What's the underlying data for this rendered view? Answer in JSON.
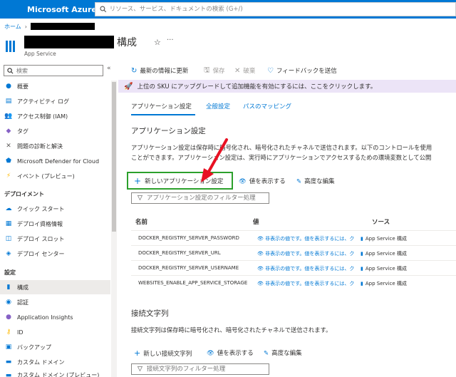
{
  "topbar": {
    "brand": "Microsoft Azure",
    "search_placeholder": "リソース、サービス、ドキュメントの検索 (G+/)"
  },
  "breadcrumb": {
    "home": "ホーム"
  },
  "resource": {
    "title": "構成",
    "type": "App Service",
    "star": "☆",
    "more": "···"
  },
  "sidebar": {
    "search_placeholder": "検索",
    "collapse": "«",
    "items_top": [
      {
        "label": "概要",
        "icon": "globe-icon",
        "color": "#0078d4"
      },
      {
        "label": "アクティビティ ログ",
        "icon": "log-icon",
        "color": "#0078d4"
      },
      {
        "label": "アクセス制御 (IAM)",
        "icon": "people-icon",
        "color": "#0078d4"
      },
      {
        "label": "タグ",
        "icon": "tag-icon",
        "color": "#8661c5"
      },
      {
        "label": "問題の診断と解決",
        "icon": "wrench-icon",
        "color": "#605e5c"
      },
      {
        "label": "Microsoft Defender for Cloud",
        "icon": "shield-icon",
        "color": "#0078d4"
      },
      {
        "label": "イベント (プレビュー)",
        "icon": "lightning-icon",
        "color": "#ffb900"
      }
    ],
    "group_deploy": "デプロイメント",
    "items_deploy": [
      {
        "label": "クイック スタート",
        "icon": "cloud-icon",
        "color": "#0078d4"
      },
      {
        "label": "デプロイ資格情報",
        "icon": "credentials-icon",
        "color": "#0078d4"
      },
      {
        "label": "デプロイ スロット",
        "icon": "slot-icon",
        "color": "#0078d4"
      },
      {
        "label": "デプロイ センター",
        "icon": "cube-icon",
        "color": "#0078d4"
      }
    ],
    "group_settings": "設定",
    "items_settings": [
      {
        "label": "構成",
        "icon": "config-icon",
        "color": "#0078d4"
      },
      {
        "label": "認証",
        "icon": "auth-icon",
        "color": "#0078d4"
      },
      {
        "label": "Application Insights",
        "icon": "bulb-icon",
        "color": "#8661c5"
      },
      {
        "label": "ID",
        "icon": "key-icon",
        "color": "#ffb900"
      },
      {
        "label": "バックアップ",
        "icon": "backup-icon",
        "color": "#0078d4"
      },
      {
        "label": "カスタム ドメイン",
        "icon": "domain-icon",
        "color": "#0078d4"
      },
      {
        "label": "カスタム ドメイン (プレビュー)",
        "icon": "domain-icon",
        "color": "#0078d4"
      }
    ]
  },
  "toolbar": {
    "refresh": "最新の情報に更新",
    "save": "保存",
    "discard": "破棄",
    "feedback": "フィードバックを送信"
  },
  "banner": {
    "text": "上位の SKU にアップグレードして追加機能を有効にするには、ここをクリックします。"
  },
  "tabs": {
    "app_settings": "アプリケーション設定",
    "general": "全般設定",
    "path_mapping": "パスのマッピング"
  },
  "app_section": {
    "title": "アプリケーション設定",
    "desc_line1": "アプリケーション設定は保存時に暗号化され、暗号化されたチャネルで送信されます。以下のコントロールを使用",
    "desc_line2": "ことができます。アプリケーション設定は、実行時にアプリケーションでアクセスするための環境変数として公開",
    "new_button": "新しいアプリケーション設定",
    "show_values": "値を表示する",
    "advanced_edit": "高度な編集",
    "filter_placeholder": "アプリケーション設定のフィルター処理"
  },
  "table": {
    "headers": {
      "name": "名前",
      "value": "値",
      "source": "ソース"
    },
    "rows": [
      {
        "name": "DOCKER_REGISTRY_SERVER_PASSWORD",
        "value": "非表示の値です。値を表示するには、ク",
        "source": "App Service 構成"
      },
      {
        "name": "DOCKER_REGISTRY_SERVER_URL",
        "value": "非表示の値です。値を表示するには、ク",
        "source": "App Service 構成"
      },
      {
        "name": "DOCKER_REGISTRY_SERVER_USERNAME",
        "value": "非表示の値です。値を表示するには、ク",
        "source": "App Service 構成"
      },
      {
        "name": "WEBSITES_ENABLE_APP_SERVICE_STORAGE",
        "value": "非表示の値です。値を表示するには、ク",
        "source": "App Service 構成"
      }
    ]
  },
  "conn_section": {
    "title": "接続文字列",
    "desc": "接続文字列は保存時に暗号化され、暗号化されたチャネルで送信されます。",
    "new_button": "新しい接続文字列",
    "show_values": "値を表示する",
    "advanced_edit": "高度な編集",
    "filter_placeholder": "接続文字列のフィルター処理"
  },
  "colors": {
    "azure_blue": "#0078d4",
    "highlight_green": "#2ca02c",
    "annotation_red": "#e81123",
    "banner_bg": "#ece4f7"
  }
}
